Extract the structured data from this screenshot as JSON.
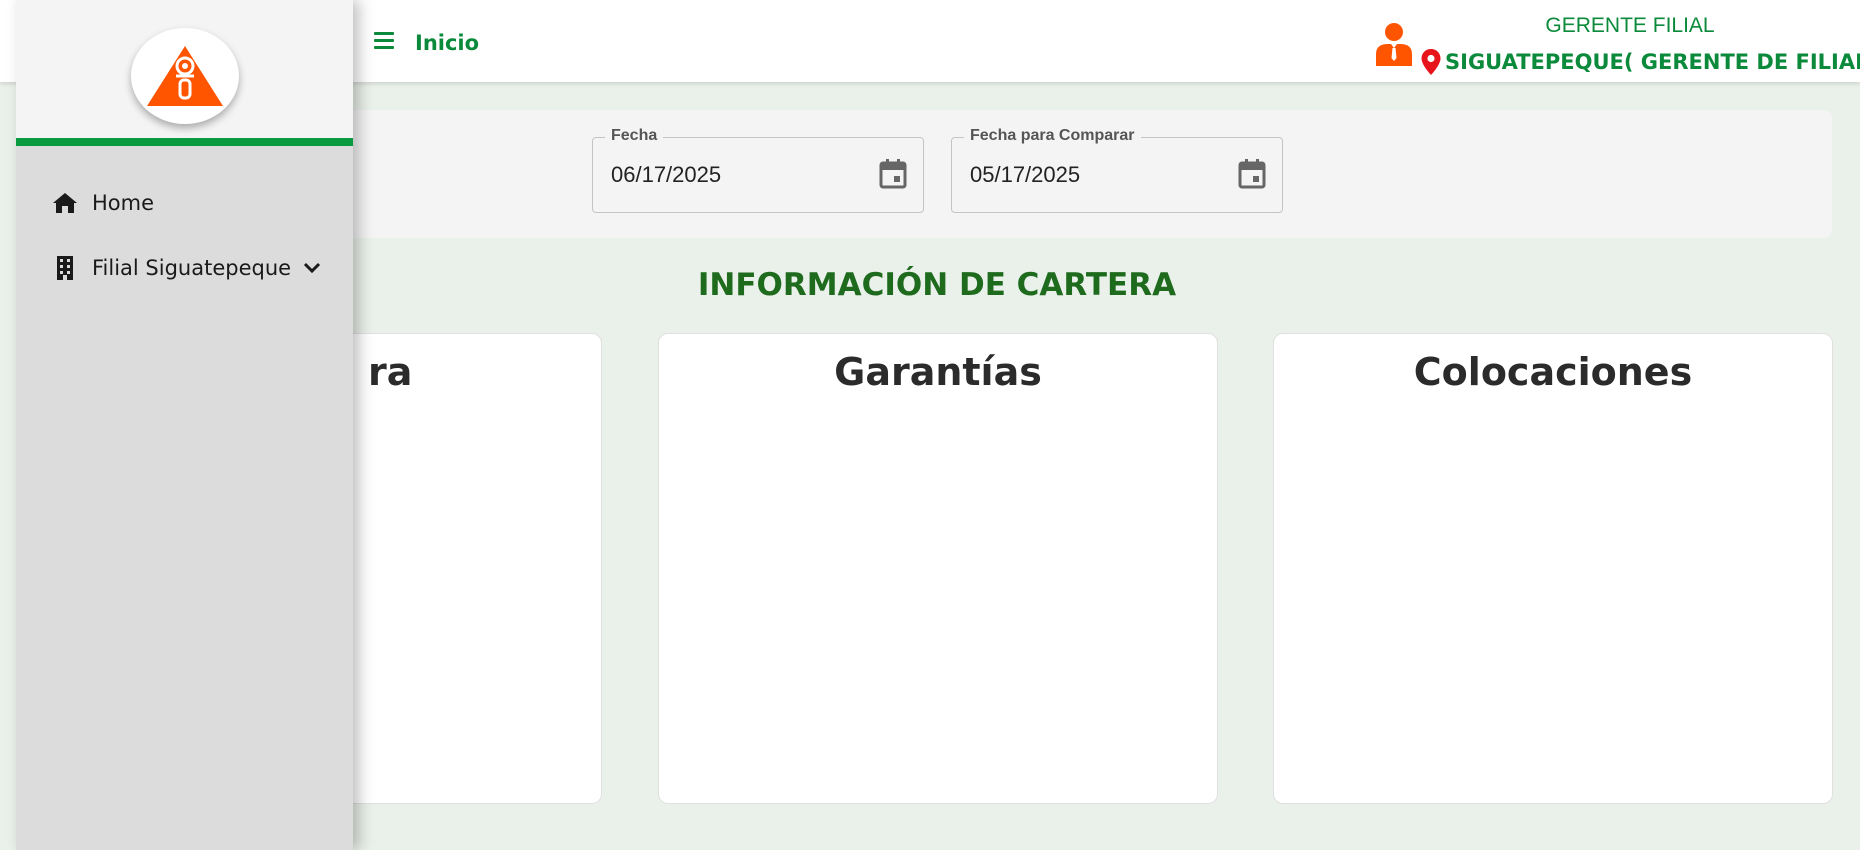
{
  "header": {
    "nav_link": "Inicio",
    "user_role": "GERENTE FILIAL",
    "user_branch": "SIGUATEPEQUE( GERENTE DE FILIAL)"
  },
  "filters": {
    "date": {
      "label": "Fecha",
      "value": "06/17/2025"
    },
    "compare_date": {
      "label": "Fecha para Comparar",
      "value": "05/17/2025"
    }
  },
  "section_title": "INFORMACIÓN DE CARTERA",
  "cards": [
    {
      "title_visible": "ra"
    },
    {
      "title": "Garantías"
    },
    {
      "title": "Colocaciones"
    }
  ],
  "sidebar": {
    "items": [
      {
        "label": "Home",
        "icon": "home-icon"
      },
      {
        "label": "Filial Siguatepeque",
        "icon": "building-icon",
        "expand_icon": "chevron-down-icon"
      }
    ]
  },
  "colors": {
    "brand_green": "#0a8a3a",
    "title_green": "#1e6b1e",
    "brand_orange": "#ff5500",
    "pin_red": "#e8141c"
  }
}
